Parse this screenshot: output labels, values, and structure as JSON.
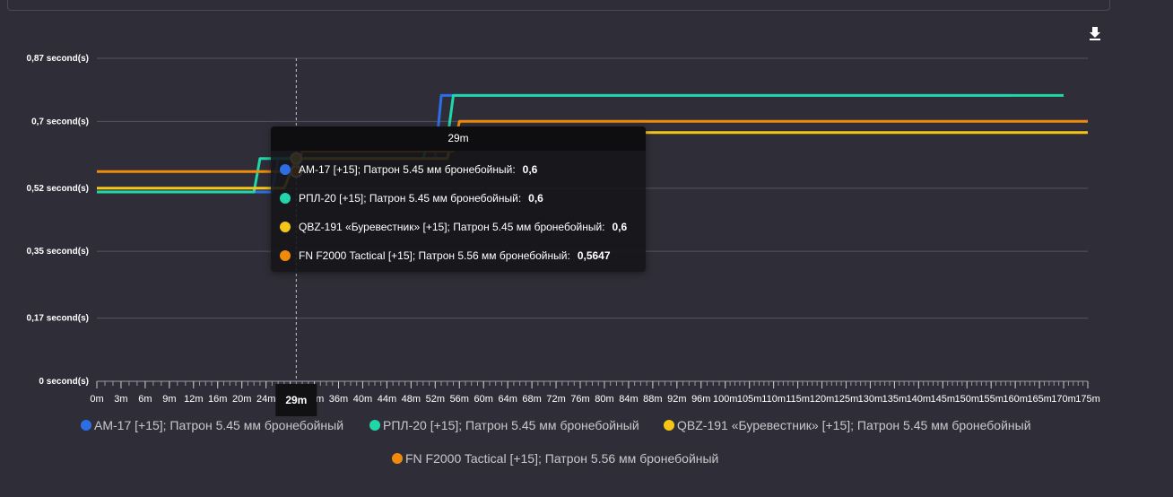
{
  "toolbar": {
    "download_icon": "download-icon"
  },
  "tooltip": {
    "title": "29m",
    "rows": [
      {
        "label": "AM-17 [+15]; Патрон 5.45 мм бронебойный:",
        "value": "0,6",
        "color": "#2d6ee6"
      },
      {
        "label": "РПЛ-20 [+15]; Патрон 5.45 мм бронебойный:",
        "value": "0,6",
        "color": "#21d6a8"
      },
      {
        "label": "QBZ-191 «Буревестник» [+15]; Патрон 5.45 мм бронебойный:",
        "value": "0,6",
        "color": "#f5c518"
      },
      {
        "label": "FN F2000 Tactical [+15]; Патрон 5.56 мм бронебойный:",
        "value": "0,5647",
        "color": "#f08a0a"
      }
    ]
  },
  "crosshair": {
    "x_value": 29,
    "label": "29m"
  },
  "legend": [
    {
      "label": "AM-17 [+15]; Патрон 5.45 мм бронебойный",
      "color": "#2d6ee6"
    },
    {
      "label": "РПЛ-20 [+15]; Патрон 5.45 мм бронебойный",
      "color": "#21d6a8"
    },
    {
      "label": "QBZ-191 «Буревестник» [+15]; Патрон 5.45 мм бронебойный",
      "color": "#f5c518"
    },
    {
      "label": "FN F2000 Tactical [+15]; Патрон 5.56 мм бронебойный",
      "color": "#f08a0a"
    }
  ],
  "chart_data": {
    "type": "line",
    "title": "",
    "xlabel": "",
    "ylabel": "",
    "grid": true,
    "legend_position": "bottom",
    "y_ticks": [
      {
        "value": 0,
        "label": "0 second(s)"
      },
      {
        "value": 0.17,
        "label": "0,17 second(s)"
      },
      {
        "value": 0.35,
        "label": "0,35 second(s)"
      },
      {
        "value": 0.52,
        "label": "0,52 second(s)"
      },
      {
        "value": 0.7,
        "label": "0,7 second(s)"
      },
      {
        "value": 0.87,
        "label": "0,87 second(s)"
      }
    ],
    "ylim": [
      0,
      0.87
    ],
    "x_ticks": [
      "0m",
      "3m",
      "6m",
      "9m",
      "12m",
      "16m",
      "20m",
      "24m",
      "28m",
      "32m",
      "36m",
      "40m",
      "44m",
      "48m",
      "52m",
      "56m",
      "60m",
      "64m",
      "68m",
      "72m",
      "76m",
      "80m",
      "84m",
      "88m",
      "92m",
      "96m",
      "100m",
      "105m",
      "110m",
      "115m",
      "120m",
      "125m",
      "130m",
      "135m",
      "140m",
      "145m",
      "150m",
      "155m",
      "160m",
      "165m",
      "170m",
      "175m"
    ],
    "series": [
      {
        "name": "AM-17 [+15]; Патрон 5.45 мм бронебойный",
        "color": "#2d6ee6",
        "points": [
          [
            0,
            0.51
          ],
          [
            25,
            0.51
          ],
          [
            26,
            0.6
          ],
          [
            52,
            0.6
          ],
          [
            53,
            0.77
          ],
          [
            159,
            0.77
          ]
        ]
      },
      {
        "name": "РПЛ-20 [+15]; Патрон 5.45 мм бронебойный",
        "color": "#21d6a8",
        "points": [
          [
            0,
            0.51
          ],
          [
            22,
            0.51
          ],
          [
            23,
            0.6
          ],
          [
            50,
            0.6
          ],
          [
            51,
            0.65
          ],
          [
            54,
            0.65
          ],
          [
            55,
            0.77
          ],
          [
            170,
            0.77
          ]
        ]
      },
      {
        "name": "QBZ-191 «Буревестник» [+15]; Патрон 5.45 мм бронебойный",
        "color": "#f5c518",
        "points": [
          [
            0,
            0.52
          ],
          [
            27,
            0.52
          ],
          [
            29,
            0.6
          ],
          [
            54,
            0.6
          ],
          [
            55,
            0.67
          ],
          [
            175,
            0.67
          ]
        ]
      },
      {
        "name": "FN F2000 Tactical [+15]; Патрон 5.56 мм бронебойный",
        "color": "#f08a0a",
        "points": [
          [
            0,
            0.5647
          ],
          [
            28,
            0.5647
          ],
          [
            29,
            0.5647
          ],
          [
            30,
            0.62
          ],
          [
            55,
            0.62
          ],
          [
            56,
            0.7
          ],
          [
            175,
            0.7
          ]
        ]
      }
    ]
  }
}
